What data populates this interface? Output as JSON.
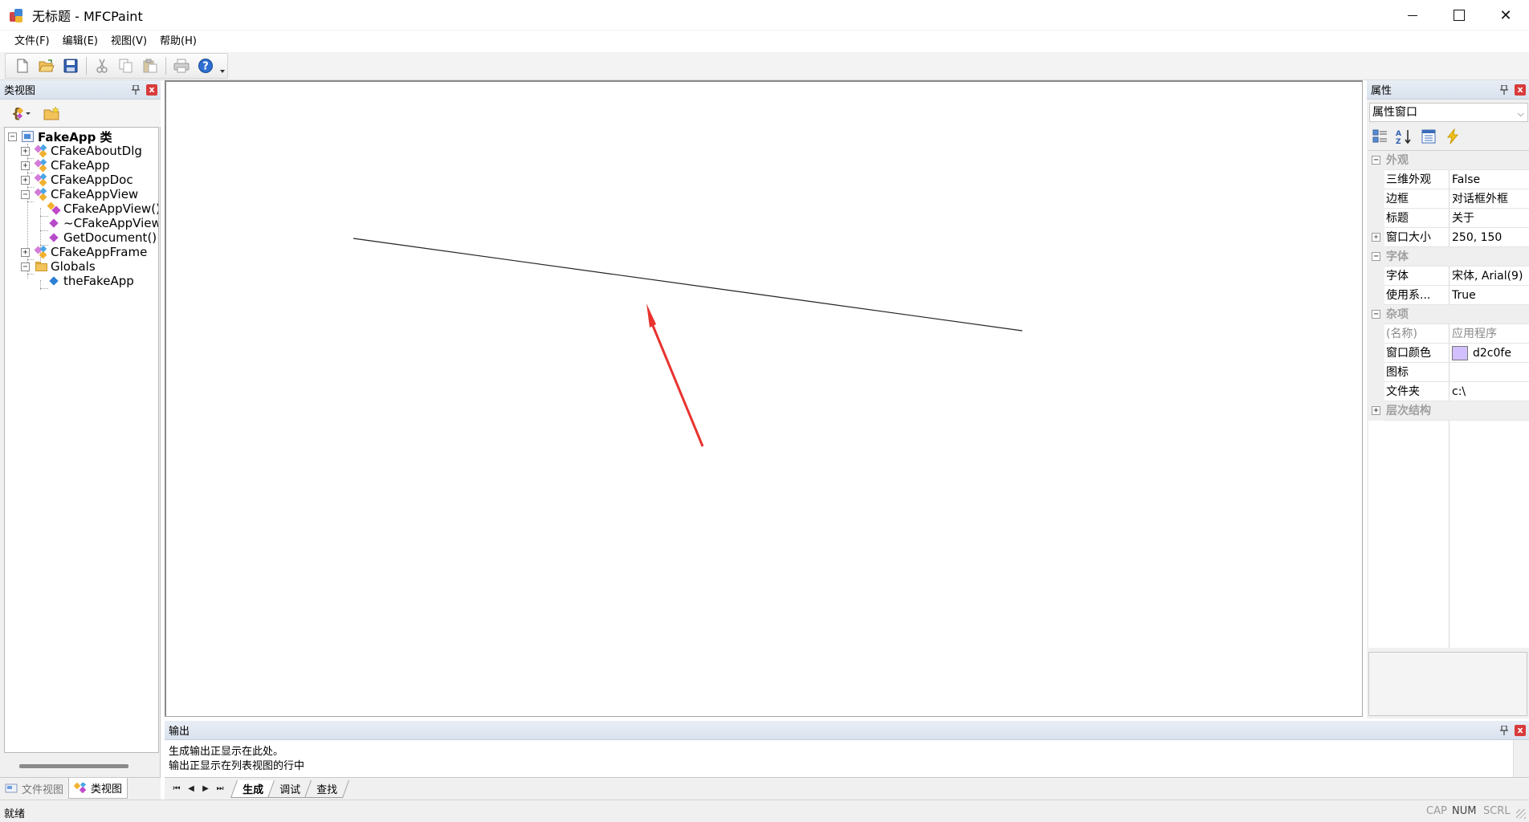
{
  "window": {
    "title": "无标题 - MFCPaint",
    "close_glyph": "✕"
  },
  "menu": [
    "文件(F)",
    "编辑(E)",
    "视图(V)",
    "帮助(H)"
  ],
  "toolbar": {
    "buttons": [
      "new-file-icon",
      "open-folder-icon",
      "save-icon",
      "cut-icon",
      "copy-icon",
      "paste-icon",
      "print-icon",
      "help-icon"
    ]
  },
  "class_view": {
    "title": "类视图",
    "pin_glyph": "📌",
    "close_glyph": "x",
    "root": "FakeApp 类",
    "items": [
      {
        "label": "CFakeAboutDlg",
        "kind": "class",
        "expander": "+"
      },
      {
        "label": "CFakeApp",
        "kind": "class",
        "expander": "+"
      },
      {
        "label": "CFakeAppDoc",
        "kind": "class",
        "expander": "+"
      },
      {
        "label": "CFakeAppView",
        "kind": "class",
        "expander": "−"
      },
      {
        "label": "CFakeAppView()",
        "kind": "ctor"
      },
      {
        "label": "~CFakeAppView()",
        "kind": "method"
      },
      {
        "label": "GetDocument()",
        "kind": "method"
      },
      {
        "label": "CFakeAppFrame",
        "kind": "class",
        "expander": "+"
      },
      {
        "label": "Globals",
        "kind": "folder",
        "expander": "−"
      },
      {
        "label": "theFakeApp",
        "kind": "var"
      }
    ],
    "root_expander": "−",
    "tabs": [
      "文件视图",
      "类视图"
    ],
    "active_tab": "类视图"
  },
  "output": {
    "title": "输出",
    "lines": [
      "生成输出正显示在此处。",
      "输出正显示在列表视图的行中"
    ],
    "tabs": [
      "生成",
      "调试",
      "查找"
    ],
    "active_tab": "生成",
    "nav": [
      "⏮",
      "◀",
      "▶",
      "⏭"
    ]
  },
  "properties": {
    "title": "属性",
    "selector": "属性窗口",
    "categories": [
      {
        "name": "外观",
        "expander": "−",
        "rows": [
          {
            "name": "三维外观",
            "value": "False"
          },
          {
            "name": "边框",
            "value": "对话框外框"
          },
          {
            "name": "标题",
            "value": "关于"
          },
          {
            "name": "窗口大小",
            "value": "250, 150",
            "expander": "+"
          }
        ]
      },
      {
        "name": "字体",
        "expander": "−",
        "rows": [
          {
            "name": "字体",
            "value": "宋体, Arial(9)"
          },
          {
            "name": "使用系...",
            "value": "True"
          }
        ]
      },
      {
        "name": "杂项",
        "expander": "−",
        "rows": [
          {
            "name": "(名称)",
            "value": "应用程序",
            "dim": true
          },
          {
            "name": "窗口颜色",
            "value": "d2c0fe",
            "swatch": "#d2c0fe"
          },
          {
            "name": "图标",
            "value": ""
          },
          {
            "name": "文件夹",
            "value": "c:\\"
          }
        ]
      },
      {
        "name": "层次结构",
        "expander": "+",
        "rows": []
      }
    ]
  },
  "status": {
    "text": "就绪",
    "indicators": [
      {
        "label": "CAP",
        "active": false
      },
      {
        "label": "NUM",
        "active": true
      },
      {
        "label": "SCRL",
        "active": false
      }
    ]
  },
  "colors": {
    "line": "#222222",
    "arrow": "#e8332f"
  }
}
